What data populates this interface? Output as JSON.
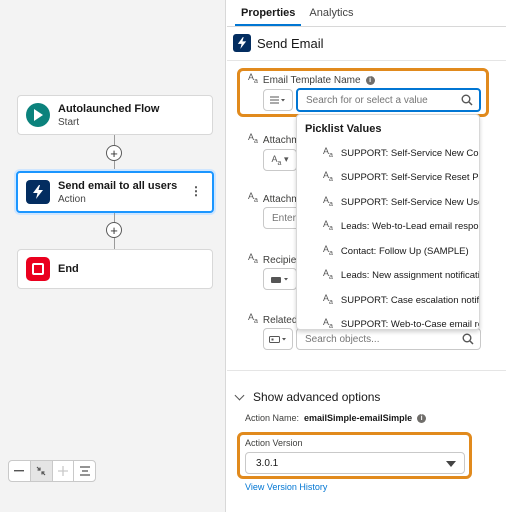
{
  "canvas": {
    "nodes": [
      {
        "title": "Autolaunched Flow",
        "subtitle": "Start"
      },
      {
        "title": "Send email to all users",
        "subtitle": "Action"
      },
      {
        "title": "End"
      }
    ]
  },
  "zoom_controls": [
    "zoom-out",
    "fit-view",
    "zoom-in",
    "auto-layout"
  ],
  "panel": {
    "tabs": [
      {
        "label": "Properties",
        "active": true
      },
      {
        "label": "Analytics",
        "active": false
      }
    ],
    "header_title": "Send Email",
    "fields": {
      "email_template": {
        "label": "Email Template Name",
        "placeholder": "Search for or select a value"
      },
      "attachment1": {
        "label": "Attachm"
      },
      "attachment2": {
        "label": "Attachm",
        "placeholder": "Enter"
      },
      "recipient": {
        "label": "Recipien"
      },
      "related": {
        "label": "Related I",
        "placeholder": "Search objects..."
      }
    },
    "picklist": {
      "title": "Picklist Values",
      "items": [
        "SUPPORT: Self-Service New Co...",
        "SUPPORT: Self-Service Reset Pa...",
        "SUPPORT: Self-Service New Use...",
        "Leads: Web-to-Lead email respo...",
        "Contact: Follow Up (SAMPLE)",
        "Leads: New assignment notificati...",
        "SUPPORT: Case escalation notifi...",
        "SUPPORT: Web-to-Case email re..."
      ]
    },
    "advanced": {
      "toggle_label": "Show advanced options",
      "action_name_label": "Action Name:",
      "action_name_value": "emailSimple-emailSimple",
      "action_version_label": "Action Version",
      "action_version_value": "3.0.1",
      "view_history_link": "View Version History"
    }
  },
  "colors": {
    "accent": "#0176d3",
    "highlight": "#e18a1d",
    "start_node": "#0b827c",
    "end_node": "#ea001e",
    "action_node": "#032d60"
  }
}
